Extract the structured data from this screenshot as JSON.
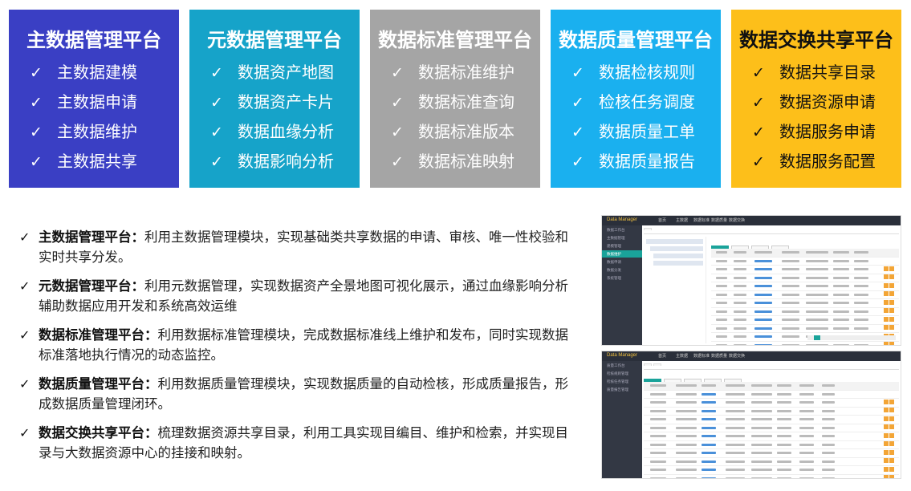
{
  "cards": [
    {
      "title": "主数据管理平台",
      "bg": "#3a3fc4",
      "items": [
        "主数据建模",
        "主数据申请",
        "主数据维护",
        "主数据共享"
      ]
    },
    {
      "title": "元数据管理平台",
      "bg": "#16a3c9",
      "items": [
        "数据资产地图",
        "数据资产卡片",
        "数据血缘分析",
        "数据影响分析"
      ]
    },
    {
      "title": "数据标准管理平台",
      "bg": "#a5a5a5",
      "items": [
        "数据标准维护",
        "数据标准查询",
        "数据标准版本",
        "数据标准映射"
      ]
    },
    {
      "title": "数据质量管理平台",
      "bg": "#1ab0ef",
      "items": [
        "数据检核规则",
        "检核任务调度",
        "数据质量工单",
        "数据质量报告"
      ]
    },
    {
      "title": "数据交换共享平台",
      "bg": "#fdbf1a",
      "text_color": "#111111",
      "items": [
        "数据共享目录",
        "数据资源申请",
        "数据服务申请",
        "数据服务配置"
      ]
    }
  ],
  "check_glyph": "✓",
  "descriptions": [
    {
      "name": "主数据管理平台：",
      "text": "利用主数据管理模块，实现基础类共享数据的申请、审核、唯一性校验和实时共享分发。"
    },
    {
      "name": "元数据管理平台：",
      "text": "利用元数据管理，实现数据资产全景地图可视化展示，通过血缘影响分析辅助数据应用开发和系统高效运维"
    },
    {
      "name": "数据标准管理平台：",
      "text": "利用数据标准管理模块，完成数据标准线上维护和发布，同时实现数据标准落地执行情况的动态监控。"
    },
    {
      "name": "数据质量管理平台：",
      "text": "利用数据质量管理模块，实现数据质量的自动检核，形成质量报告，形成数据质量管理闭环。"
    },
    {
      "name": "数据交换共享平台：",
      "text": "梳理数据资源共享目录，利用工具实现目编目、维护和检索，并实现目录与大数据资源中心的挂接和映射。"
    }
  ],
  "screenshots": {
    "logo": "Data Manager",
    "nav": [
      "首页",
      "主数据",
      "数据标准",
      "数据质量",
      "数据交换"
    ],
    "shot1_side": [
      "数据工作台",
      "主数据管理",
      "建模管理",
      "数据维护",
      "数据申请",
      "数据分发",
      "系统管理"
    ],
    "shot2_side": [
      "质量工作台",
      "检核规则管理",
      "检核任务管理",
      "质量报告管理"
    ]
  }
}
